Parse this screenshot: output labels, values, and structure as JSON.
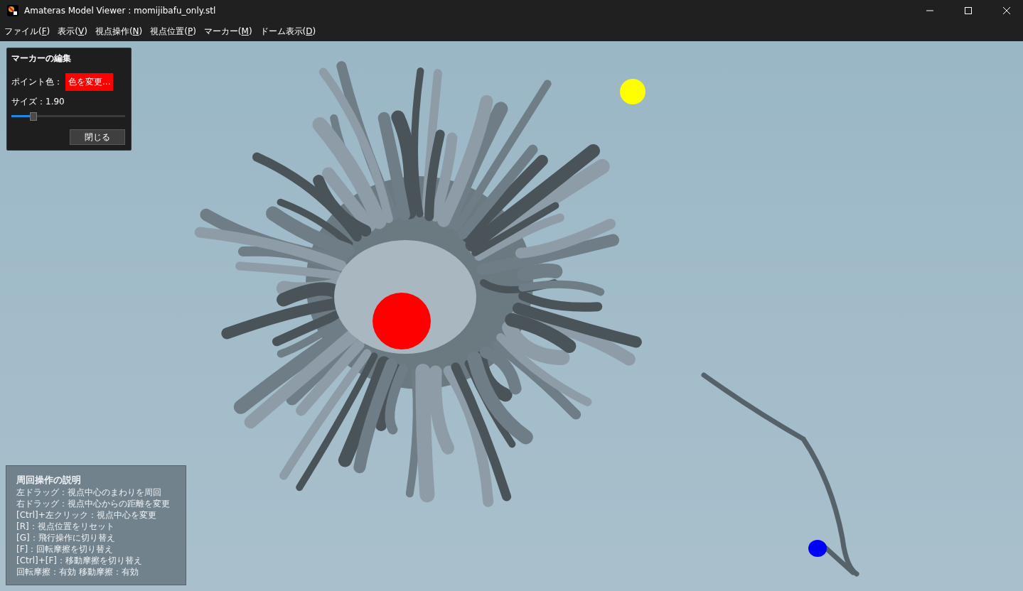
{
  "window": {
    "title": "Amateras Model Viewer : momijibafu_only.stl"
  },
  "menu": [
    {
      "text": "ファイル(",
      "key": "F",
      "tail": ")"
    },
    {
      "text": "表示(",
      "key": "V",
      "tail": ")"
    },
    {
      "text": "視点操作(",
      "key": "N",
      "tail": ")"
    },
    {
      "text": "視点位置(",
      "key": "P",
      "tail": ")"
    },
    {
      "text": "マーカー(",
      "key": "M",
      "tail": ")"
    },
    {
      "text": "ドーム表示(",
      "key": "D",
      "tail": ")"
    }
  ],
  "marker_panel": {
    "title": "マーカーの編集",
    "color_label": "ポイント色：",
    "color_button": "色を変更...",
    "color": "#ff0000",
    "size_label": "サイズ：1.90",
    "size_slider": {
      "level": 0.2
    },
    "close_button": "閉じる"
  },
  "markers": [
    {
      "color": "#ffff00"
    },
    {
      "color": "#ff0000"
    },
    {
      "color": "#0000ff"
    }
  ],
  "help_panel": {
    "title": "周回操作の説明",
    "lines": [
      "左ドラッグ：視点中心のまわりを周回",
      "右ドラッグ：視点中心からの距離を変更",
      "[Ctrl]+左クリック：視点中心を変更",
      "[R]：視点位置をリセット",
      "[G]：飛行操作に切り替え",
      "[F]：回転摩擦を切り替え",
      "[Ctrl]+[F]：移動摩擦を切り替え",
      "回転摩擦：有効 移動摩擦：有効"
    ]
  }
}
